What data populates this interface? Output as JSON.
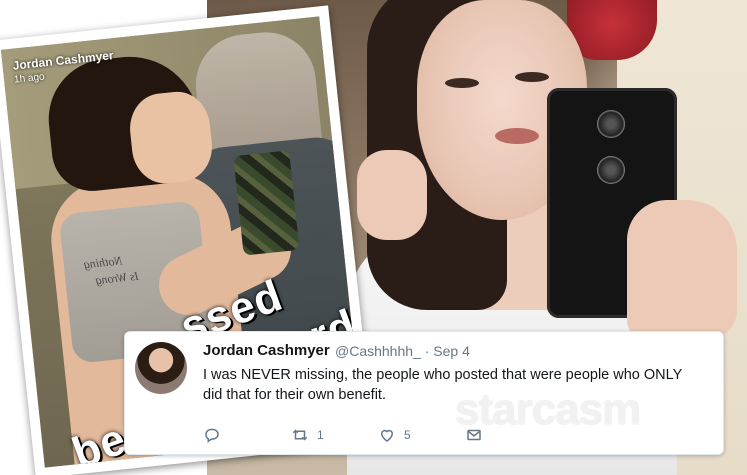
{
  "snapchat": {
    "author": "Jordan Cashmyer",
    "time_ago": "1h ago",
    "caption_line1": "ssed",
    "caption_line2": "ords",
    "caption_bottom": "be",
    "shirt_line1": "Nothing",
    "shirt_line2": "Is Wrong"
  },
  "tweet": {
    "display_name": "Jordan Cashmyer",
    "handle_date": "@Cashhhhh_ · Sep 4",
    "text": "I was NEVER missing, the people who posted that were people who ONLY did that for their own benefit.",
    "retweet_count": "1",
    "like_count": "5",
    "icons": [
      "reply-icon",
      "retweet-icon",
      "like-icon",
      "message-icon"
    ]
  },
  "watermark": "starcasm"
}
